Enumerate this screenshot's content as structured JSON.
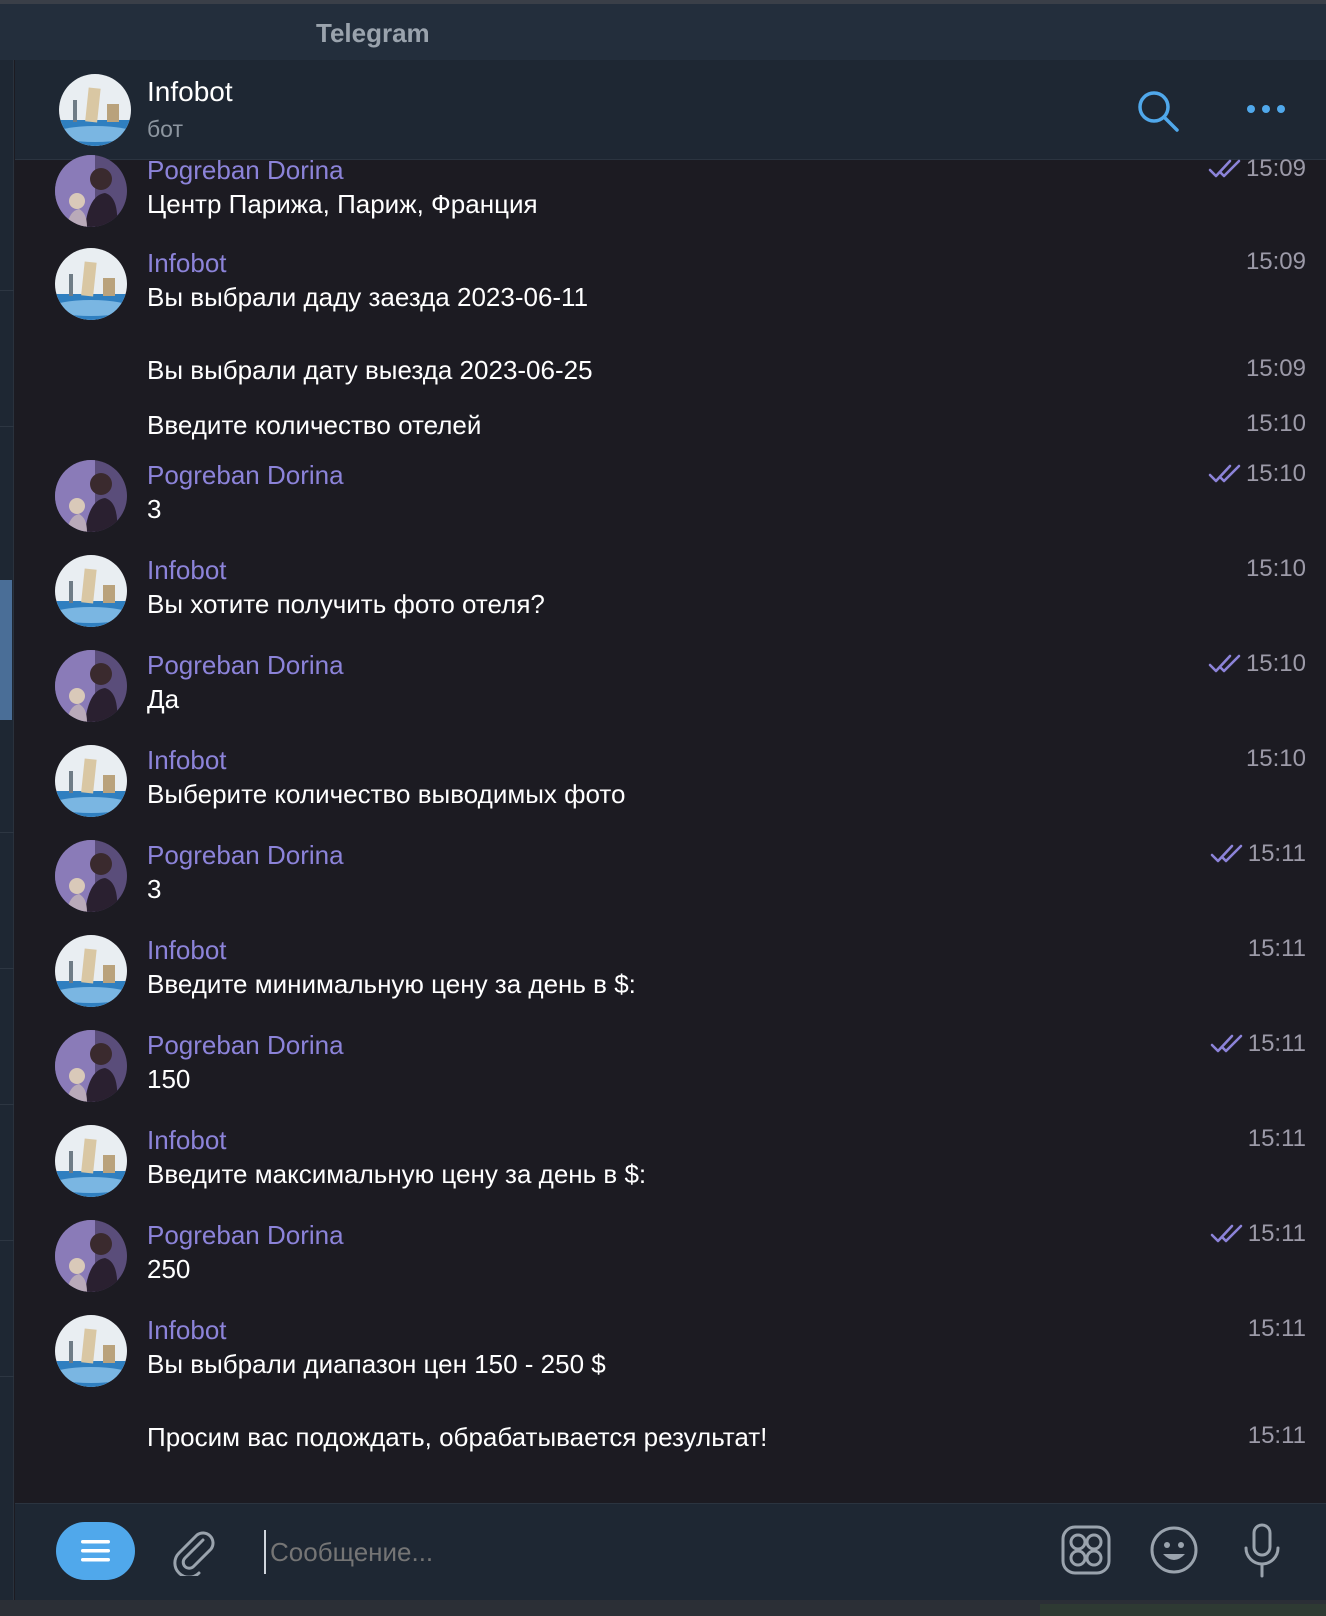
{
  "window": {
    "title": "Telegram"
  },
  "chat_header": {
    "name": "Infobot",
    "status": "бот",
    "search_icon": "search-icon",
    "more_icon": "more-dots-icon"
  },
  "colors": {
    "accent": "#50a8eb",
    "sender": "#8c83d9",
    "background": "#1c1b22",
    "panel": "#1e2733"
  },
  "messages": [
    {
      "sender": "Pogreban Dorina",
      "avatar": "user",
      "text": "Центр Парижа, Париж, Франция",
      "time": "15:09",
      "read": true
    },
    {
      "sender": "Infobot",
      "avatar": "bot",
      "text": "Вы выбрали даду заезда 2023-06-11",
      "time": "15:09",
      "read": false
    },
    {
      "sender": "",
      "avatar": "",
      "text": "Вы выбрали дату выезда 2023-06-25",
      "time": "15:09",
      "read": false
    },
    {
      "sender": "",
      "avatar": "",
      "text": "Введите количество отелей",
      "time": "15:10",
      "read": false
    },
    {
      "sender": "Pogreban Dorina",
      "avatar": "user",
      "text": "3",
      "time": "15:10",
      "read": true
    },
    {
      "sender": "Infobot",
      "avatar": "bot",
      "text": "Вы хотите получить фото отеля?",
      "time": "15:10",
      "read": false
    },
    {
      "sender": "Pogreban Dorina",
      "avatar": "user",
      "text": "Да",
      "time": "15:10",
      "read": true
    },
    {
      "sender": "Infobot",
      "avatar": "bot",
      "text": "Выберите количество выводимых фото",
      "time": "15:10",
      "read": false
    },
    {
      "sender": "Pogreban Dorina",
      "avatar": "user",
      "text": "3",
      "time": "15:11",
      "read": true
    },
    {
      "sender": "Infobot",
      "avatar": "bot",
      "text": "Введите минимальную цену за день в $:",
      "time": "15:11",
      "read": false
    },
    {
      "sender": "Pogreban Dorina",
      "avatar": "user",
      "text": "150",
      "time": "15:11",
      "read": true
    },
    {
      "sender": "Infobot",
      "avatar": "bot",
      "text": "Введите максимальную цену за день в $:",
      "time": "15:11",
      "read": false
    },
    {
      "sender": "Pogreban Dorina",
      "avatar": "user",
      "text": "250",
      "time": "15:11",
      "read": true
    },
    {
      "sender": "Infobot",
      "avatar": "bot",
      "text": "Вы выбрали диапазон цен 150 - 250 $",
      "time": "15:11",
      "read": false
    },
    {
      "sender": "",
      "avatar": "",
      "text": "Просим вас подождать, обрабатывается результат!",
      "time": "15:11",
      "read": false
    }
  ],
  "composer": {
    "placeholder": "Сообщение...",
    "menu_icon": "menu-icon",
    "attach_icon": "paperclip-icon",
    "sticker_icon": "sticker-icon",
    "emoji_icon": "emoji-icon",
    "mic_icon": "microphone-icon"
  }
}
